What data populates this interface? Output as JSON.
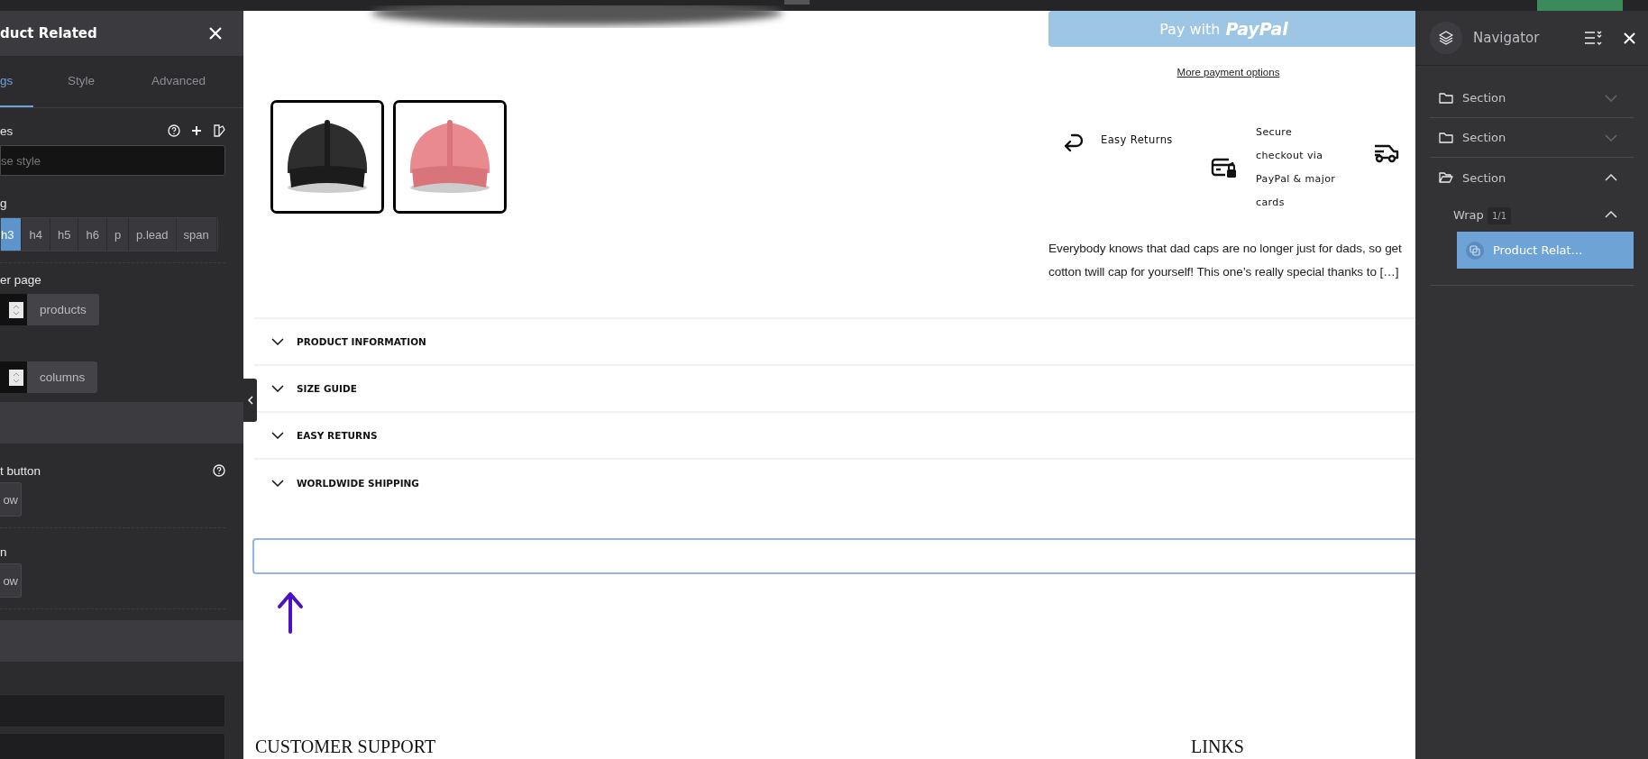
{
  "panel": {
    "title": "duct Related",
    "tabs": [
      {
        "label": "gs",
        "selected": true
      },
      {
        "label": "Style",
        "selected": false
      },
      {
        "label": "Advanced",
        "selected": false
      }
    ],
    "controls": [
      {
        "kind": "styles",
        "label": "es",
        "placeholder": "se style"
      },
      {
        "kind": "tag",
        "label": "g",
        "options": [
          {
            "label": "h3",
            "selected": true
          },
          {
            "label": "h4",
            "selected": false
          },
          {
            "label": "h5",
            "selected": false
          },
          {
            "label": "h6",
            "selected": false
          },
          {
            "label": "p",
            "selected": false
          },
          {
            "label": "p.lead",
            "selected": false
          },
          {
            "label": "span",
            "selected": false
          }
        ]
      },
      {
        "kind": "number",
        "label": "er page",
        "unit": "products"
      },
      {
        "kind": "number",
        "unit": "columns"
      },
      {
        "kind": "band"
      },
      {
        "kind": "help_toggle",
        "label": "t button",
        "button": "ow"
      },
      {
        "kind": "toggle",
        "label": "n",
        "button": "ow"
      },
      {
        "kind": "band"
      },
      {
        "kind": "input"
      },
      {
        "kind": "input"
      }
    ]
  },
  "canvas": {
    "thumbnails": [
      {
        "kind": "picture"
      },
      {
        "kind": "picture"
      }
    ],
    "pay_button": {
      "prefix": "Pay with",
      "brand": "PayPal"
    },
    "more_link": "More payment options",
    "features": [
      {
        "kind": "returns",
        "lines": [
          "Easy Returns"
        ]
      },
      {
        "kind": "secure",
        "lines": [
          "Secure",
          "checkout via",
          "PayPal & major",
          "cards"
        ]
      },
      {
        "kind": "shipping"
      }
    ],
    "description_lines": [
      "Everybody knows that dad caps are no longer just for dads, so get",
      "cotton twill cap for yourself! This one’s really special thanks to […]"
    ],
    "accordion": [
      {
        "label": "PRODUCT INFORMATION",
        "expanded": false
      },
      {
        "label": "SIZE GUIDE",
        "expanded": false
      },
      {
        "label": "EASY RETURNS",
        "expanded": false
      },
      {
        "label": "WORLDWIDE SHIPPING",
        "expanded": false
      }
    ],
    "footer": [
      "CUSTOMER SUPPORT",
      "LINKS"
    ]
  },
  "navigator": {
    "title": "Navigator",
    "items": [
      {
        "label": "Section",
        "expanded": false,
        "selected": false
      },
      {
        "label": "Section",
        "expanded": false,
        "selected": false
      },
      {
        "label": "Section",
        "expanded": true,
        "selected": false,
        "children": [
          {
            "label": "Wrap",
            "badge": "1/1",
            "expanded": true,
            "selected": false,
            "children": [
              {
                "label": "Product Relat…",
                "selected": true
              }
            ]
          }
        ]
      }
    ]
  }
}
